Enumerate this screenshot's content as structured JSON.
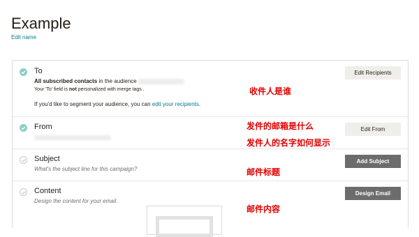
{
  "page": {
    "title": "Example",
    "edit_name": "Edit name"
  },
  "sections": {
    "to": {
      "title": "To",
      "line1_bold": "All subscribed contacts",
      "line1_rest": " in the audience",
      "line2_pre": "Your 'To' field is ",
      "line2_bold": "not",
      "line2_post": " personalized with merge tags .",
      "line3_pre": "If you'd like to segment your audience, you can ",
      "line3_link": "edit your recipients",
      "line3_post": ".",
      "button": "Edit Recipients",
      "status": "complete"
    },
    "from": {
      "title": "From",
      "button": "Edit From",
      "status": "complete"
    },
    "subject": {
      "title": "Subject",
      "subtitle": "What's the subject line for this campaign?",
      "button": "Add Subject",
      "status": "incomplete"
    },
    "content": {
      "title": "Content",
      "subtitle": "Design the content for your email.",
      "button": "Design Email",
      "status": "incomplete"
    }
  },
  "annotations": {
    "to": "收件人是谁",
    "from_1": "发件的邮箱是什么",
    "from_2": "发件人的名字如何显示",
    "subject": "邮件标题",
    "content": "邮件内容"
  },
  "colors": {
    "accent": "#007c89",
    "check": "#8ccfc4",
    "annotation": "#e00000",
    "dark_button": "#6e6c6a"
  }
}
